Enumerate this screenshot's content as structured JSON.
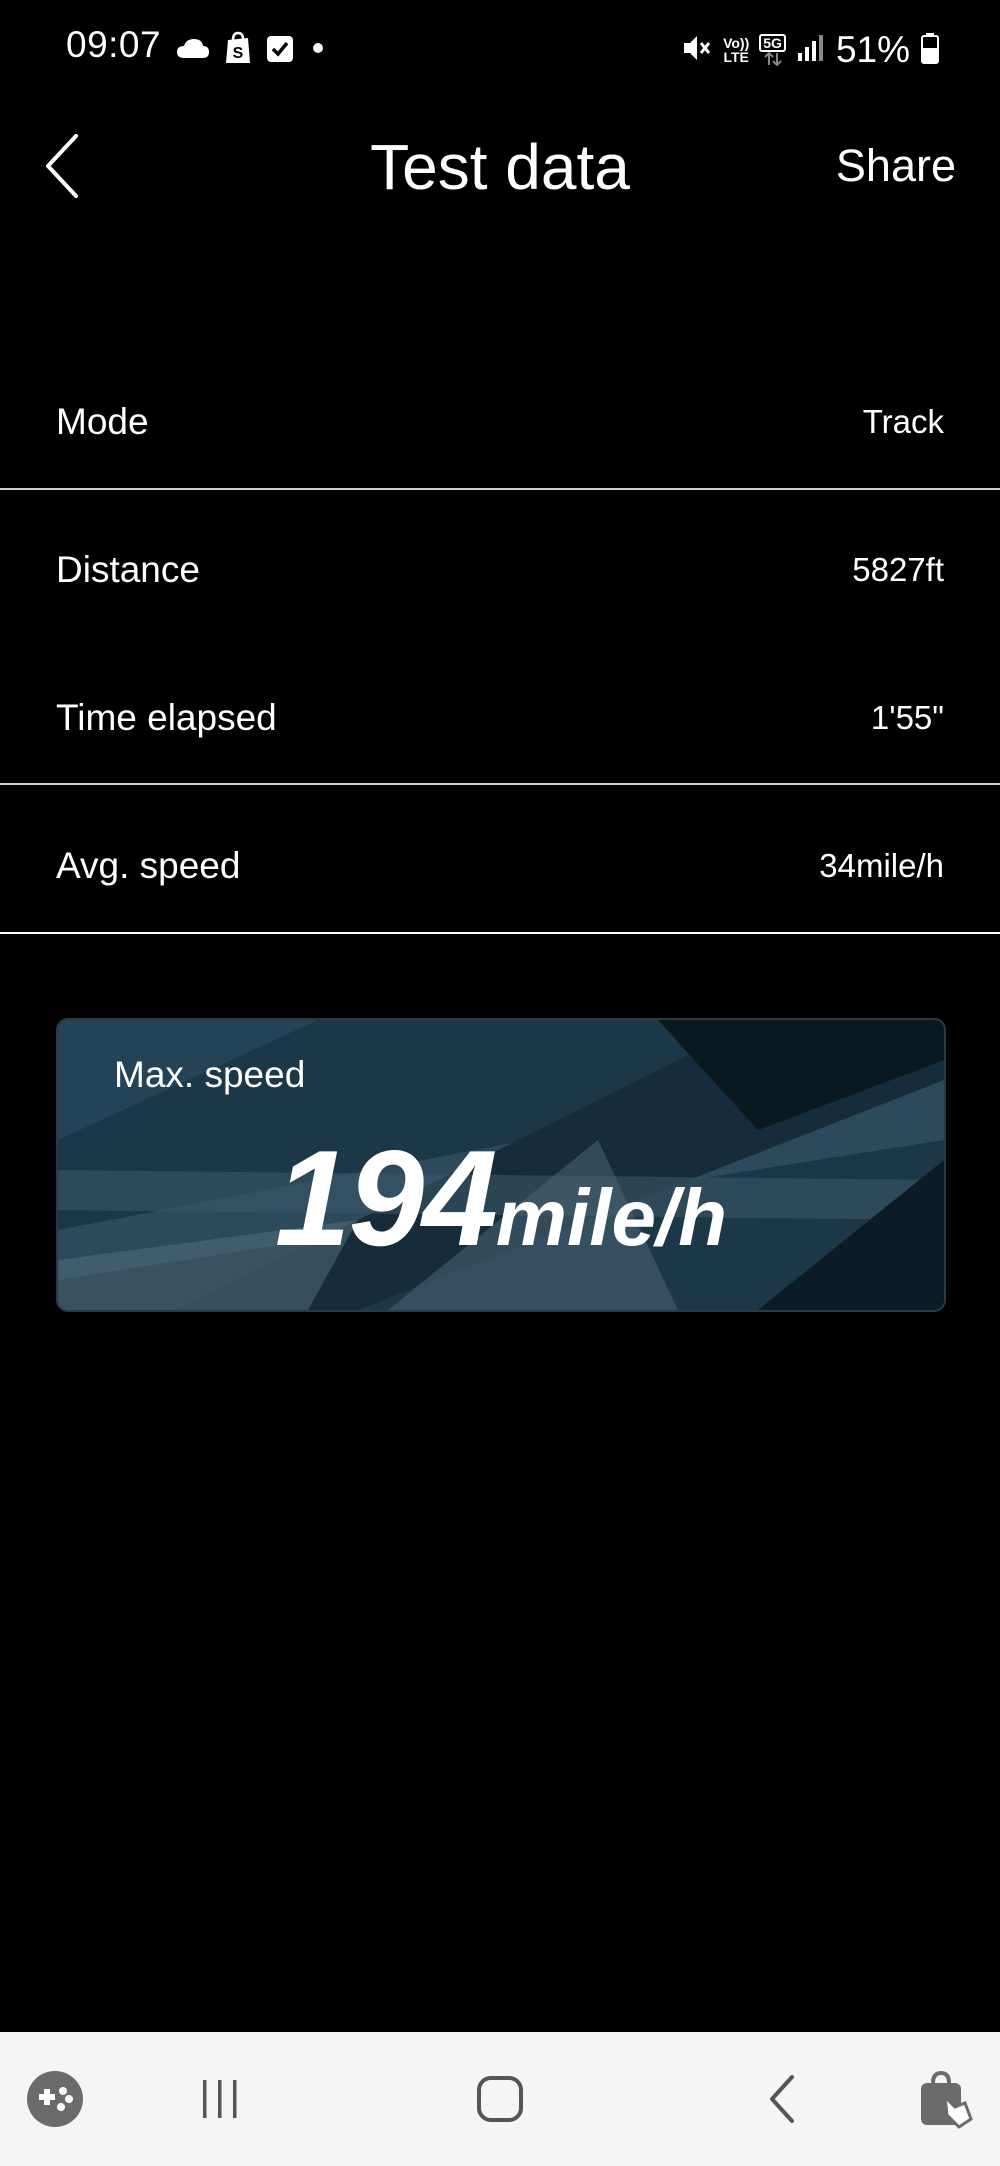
{
  "status_bar": {
    "time": "09:07",
    "battery": "51%",
    "network_5g": "5G",
    "volte_top": "Vo))",
    "volte_bottom": "LTE"
  },
  "header": {
    "title": "Test data",
    "share_label": "Share"
  },
  "rows": [
    {
      "label": "Mode",
      "value": "Track"
    },
    {
      "label": "Distance",
      "value": "5827ft"
    },
    {
      "label": "Time elapsed",
      "value": "1'55\""
    },
    {
      "label": "Avg. speed",
      "value": "34mile/h"
    }
  ],
  "max_speed": {
    "label": "Max. speed",
    "value": "194",
    "unit": "mile/h"
  },
  "nav_bar": {
    "icons": [
      "game-launcher-icon",
      "recent-apps-icon",
      "home-icon",
      "back-icon",
      "assistant-icon"
    ]
  },
  "colors": {
    "background": "#000000",
    "text": "#ffffff",
    "divider": "#cfcfcf",
    "card": "#1d3a4c",
    "nav_bar": "#f5f5f7"
  }
}
